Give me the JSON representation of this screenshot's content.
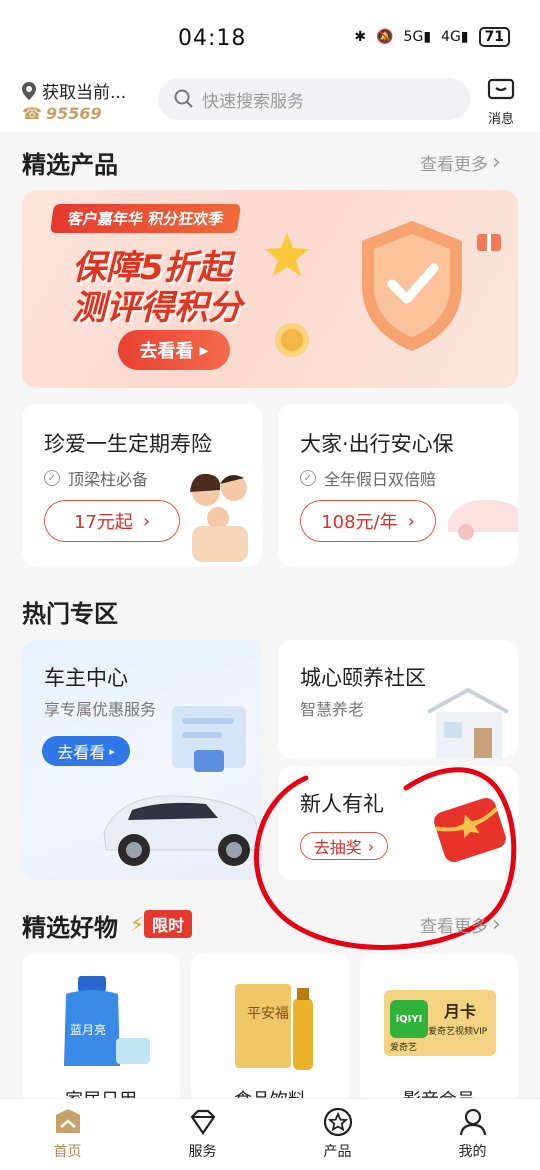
{
  "status_bar": {
    "time": "04:18",
    "signal_a": "5G",
    "signal_b": "4G",
    "battery": "71"
  },
  "header": {
    "location": "获取当前...",
    "phone": "95569",
    "search_placeholder": "快速搜索服务",
    "message_label": "消息"
  },
  "featured": {
    "title": "精选产品",
    "more": "查看更多",
    "banner": {
      "ribbon": "客户嘉年华 积分狂欢季",
      "line1": "保障5折起",
      "line2": "测评得积分",
      "button": "去看看"
    },
    "products": [
      {
        "title": "珍爱一生定期寿险",
        "tag": "顶梁柱必备",
        "price": "17元起"
      },
      {
        "title": "大家·出行安心保",
        "tag": "全年假日双倍赔",
        "price": "108元/年"
      }
    ]
  },
  "hot": {
    "title": "热门专区",
    "car": {
      "title": "车主中心",
      "sub": "享专属优惠服务",
      "button": "去看看"
    },
    "community": {
      "title": "城心颐养社区",
      "sub": "智慧养老"
    },
    "newbie": {
      "title": "新人有礼",
      "button": "去抽奖"
    }
  },
  "goods": {
    "title": "精选好物",
    "badge": "限时",
    "more": "查看更多",
    "items": [
      {
        "label": "家居日用",
        "product_brand": "蓝月亮"
      },
      {
        "label": "食品饮料",
        "product_brand": "平安福"
      },
      {
        "label": "影音会员",
        "product_brand": "爱奇艺",
        "card_title": "月卡",
        "card_sub": "爱奇艺视频VIP"
      }
    ]
  },
  "bottom_nav": [
    {
      "label": "首页",
      "icon": "home-icon",
      "active": true
    },
    {
      "label": "服务",
      "icon": "diamond-icon",
      "active": false
    },
    {
      "label": "产品",
      "icon": "star-icon",
      "active": false
    },
    {
      "label": "我的",
      "icon": "user-icon",
      "active": false
    }
  ],
  "colors": {
    "accent_red": "#e2331e",
    "gold": "#b08a55",
    "blue": "#2f77e7",
    "annotation": "#e60012"
  }
}
